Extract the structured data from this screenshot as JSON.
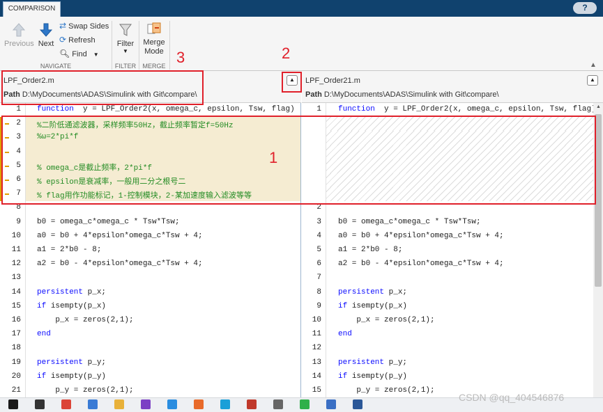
{
  "tab": {
    "label": "COMPARISON"
  },
  "help": {
    "label": "?"
  },
  "toolbar": {
    "previous": "Previous",
    "next": "Next",
    "swap_sides": "Swap Sides",
    "refresh": "Refresh",
    "find": "Find",
    "filter": "Filter",
    "merge_mode_line1": "Merge",
    "merge_mode_line2": "Mode",
    "groups": {
      "navigate": "NAVIGATE",
      "filter": "FILTER",
      "merge": "MERGE"
    }
  },
  "left": {
    "filename": "LPF_Order2.m",
    "path_label": "Path",
    "path": "D:\\MyDocuments\\ADAS\\Simulink with Git\\compare\\"
  },
  "right": {
    "filename": "LPF_Order21.m",
    "path_label": "Path",
    "path": "D:\\MyDocuments\\ADAS\\Simulink with Git\\compare\\"
  },
  "annotations": {
    "a1": "1",
    "a2": "2",
    "a3": "3"
  },
  "watermark": "CSDN @qq_404546876",
  "colors": {
    "accent": "#10426e",
    "changed_bg": "#f5ecd2",
    "changed_marker": "#e0a000",
    "annotation": "#e0202a"
  },
  "left_lines": [
    {
      "n": "1",
      "tokens": [
        [
          "kw",
          "function"
        ],
        [
          "",
          "  y = LPF_Order2(x, omega_c, epsilon, Tsw, flag)"
        ]
      ],
      "changed": false
    },
    {
      "n": "2",
      "tokens": [
        [
          "cm",
          "%二阶低通滤波器，采样频率50Hz，截止频率暂定f=50Hz"
        ]
      ],
      "changed": true
    },
    {
      "n": "3",
      "tokens": [
        [
          "cm",
          "%ω=2*pi*f"
        ]
      ],
      "changed": true
    },
    {
      "n": "4",
      "tokens": [],
      "changed": true
    },
    {
      "n": "5",
      "tokens": [
        [
          "cm",
          "% omega_c是截止频率，2*pi*f"
        ]
      ],
      "changed": true
    },
    {
      "n": "6",
      "tokens": [
        [
          "cm",
          "% epsilon是衰减率，一般用二分之根号二"
        ]
      ],
      "changed": true
    },
    {
      "n": "7",
      "tokens": [
        [
          "cm",
          "% flag用作功能标记，1-控制模块，2-某加速度输入滤波等等"
        ]
      ],
      "changed": true
    },
    {
      "n": "8",
      "tokens": [],
      "changed": false
    },
    {
      "n": "9",
      "tokens": [
        [
          "",
          "b0 = omega_c*omega_c * Tsw*Tsw;"
        ]
      ],
      "changed": false
    },
    {
      "n": "10",
      "tokens": [
        [
          "",
          "a0 = b0 + 4*epsilon*omega_c*Tsw + 4;"
        ]
      ],
      "changed": false
    },
    {
      "n": "11",
      "tokens": [
        [
          "",
          "a1 = 2*b0 - 8;"
        ]
      ],
      "changed": false
    },
    {
      "n": "12",
      "tokens": [
        [
          "",
          "a2 = b0 - 4*epsilon*omega_c*Tsw + 4;"
        ]
      ],
      "changed": false
    },
    {
      "n": "13",
      "tokens": [],
      "changed": false
    },
    {
      "n": "14",
      "tokens": [
        [
          "kw",
          "persistent"
        ],
        [
          "",
          ""
        ],
        [
          "",
          "p_x;"
        ]
      ],
      "changed": false
    },
    {
      "n": "15",
      "tokens": [
        [
          "kw",
          "if"
        ],
        [
          "",
          "isempty(p_x)"
        ]
      ],
      "changed": false
    },
    {
      "n": "16",
      "tokens": [
        [
          "",
          "    p_x = zeros(2,1);"
        ]
      ],
      "changed": false
    },
    {
      "n": "17",
      "tokens": [
        [
          "kw",
          "end"
        ]
      ],
      "changed": false
    },
    {
      "n": "18",
      "tokens": [],
      "changed": false
    },
    {
      "n": "19",
      "tokens": [
        [
          "kw",
          "persistent"
        ],
        [
          "",
          "p_y;"
        ]
      ],
      "changed": false
    },
    {
      "n": "20",
      "tokens": [
        [
          "kw",
          "if"
        ],
        [
          "",
          "isempty(p_y)"
        ]
      ],
      "changed": false
    },
    {
      "n": "21",
      "tokens": [
        [
          "",
          "    p_y = zeros(2,1);"
        ]
      ],
      "changed": false
    }
  ],
  "right_lines": [
    {
      "n": "1",
      "tokens": [
        [
          "kw",
          "function"
        ],
        [
          "",
          "  y = LPF_Order2(x, omega_c, epsilon, Tsw, flag)"
        ]
      ],
      "changed": false
    },
    {
      "n": "",
      "tokens": [],
      "changed": true
    },
    {
      "n": "",
      "tokens": [],
      "changed": true
    },
    {
      "n": "",
      "tokens": [],
      "changed": true
    },
    {
      "n": "",
      "tokens": [],
      "changed": true
    },
    {
      "n": "",
      "tokens": [],
      "changed": true
    },
    {
      "n": "",
      "tokens": [],
      "changed": true
    },
    {
      "n": "2",
      "tokens": [],
      "changed": false
    },
    {
      "n": "3",
      "tokens": [
        [
          "",
          "b0 = omega_c*omega_c * Tsw*Tsw;"
        ]
      ],
      "changed": false
    },
    {
      "n": "4",
      "tokens": [
        [
          "",
          "a0 = b0 + 4*epsilon*omega_c*Tsw + 4;"
        ]
      ],
      "changed": false
    },
    {
      "n": "5",
      "tokens": [
        [
          "",
          "a1 = 2*b0 - 8;"
        ]
      ],
      "changed": false
    },
    {
      "n": "6",
      "tokens": [
        [
          "",
          "a2 = b0 - 4*epsilon*omega_c*Tsw + 4;"
        ]
      ],
      "changed": false
    },
    {
      "n": "7",
      "tokens": [],
      "changed": false
    },
    {
      "n": "8",
      "tokens": [
        [
          "kw",
          "persistent"
        ],
        [
          "",
          "p_x;"
        ]
      ],
      "changed": false
    },
    {
      "n": "9",
      "tokens": [
        [
          "kw",
          "if"
        ],
        [
          "",
          "isempty(p_x)"
        ]
      ],
      "changed": false
    },
    {
      "n": "10",
      "tokens": [
        [
          "",
          "    p_x = zeros(2,1);"
        ]
      ],
      "changed": false
    },
    {
      "n": "11",
      "tokens": [
        [
          "kw",
          "end"
        ]
      ],
      "changed": false
    },
    {
      "n": "12",
      "tokens": [],
      "changed": false
    },
    {
      "n": "13",
      "tokens": [
        [
          "kw",
          "persistent"
        ],
        [
          "",
          "p_y;"
        ]
      ],
      "changed": false
    },
    {
      "n": "14",
      "tokens": [
        [
          "kw",
          "if"
        ],
        [
          "",
          "isempty(p_y)"
        ]
      ],
      "changed": false
    },
    {
      "n": "15",
      "tokens": [
        [
          "",
          "    p_y = zeros(2,1);"
        ]
      ],
      "changed": false
    }
  ],
  "taskbar_icons": [
    "start-icon",
    "search-icon",
    "chrome-icon",
    "files-icon",
    "folder-icon",
    "visual-studio-icon",
    "vscode-icon",
    "matlab-icon",
    "edge-icon",
    "git-icon",
    "tool-icon",
    "wechat-icon",
    "app-icon",
    "word-icon"
  ]
}
